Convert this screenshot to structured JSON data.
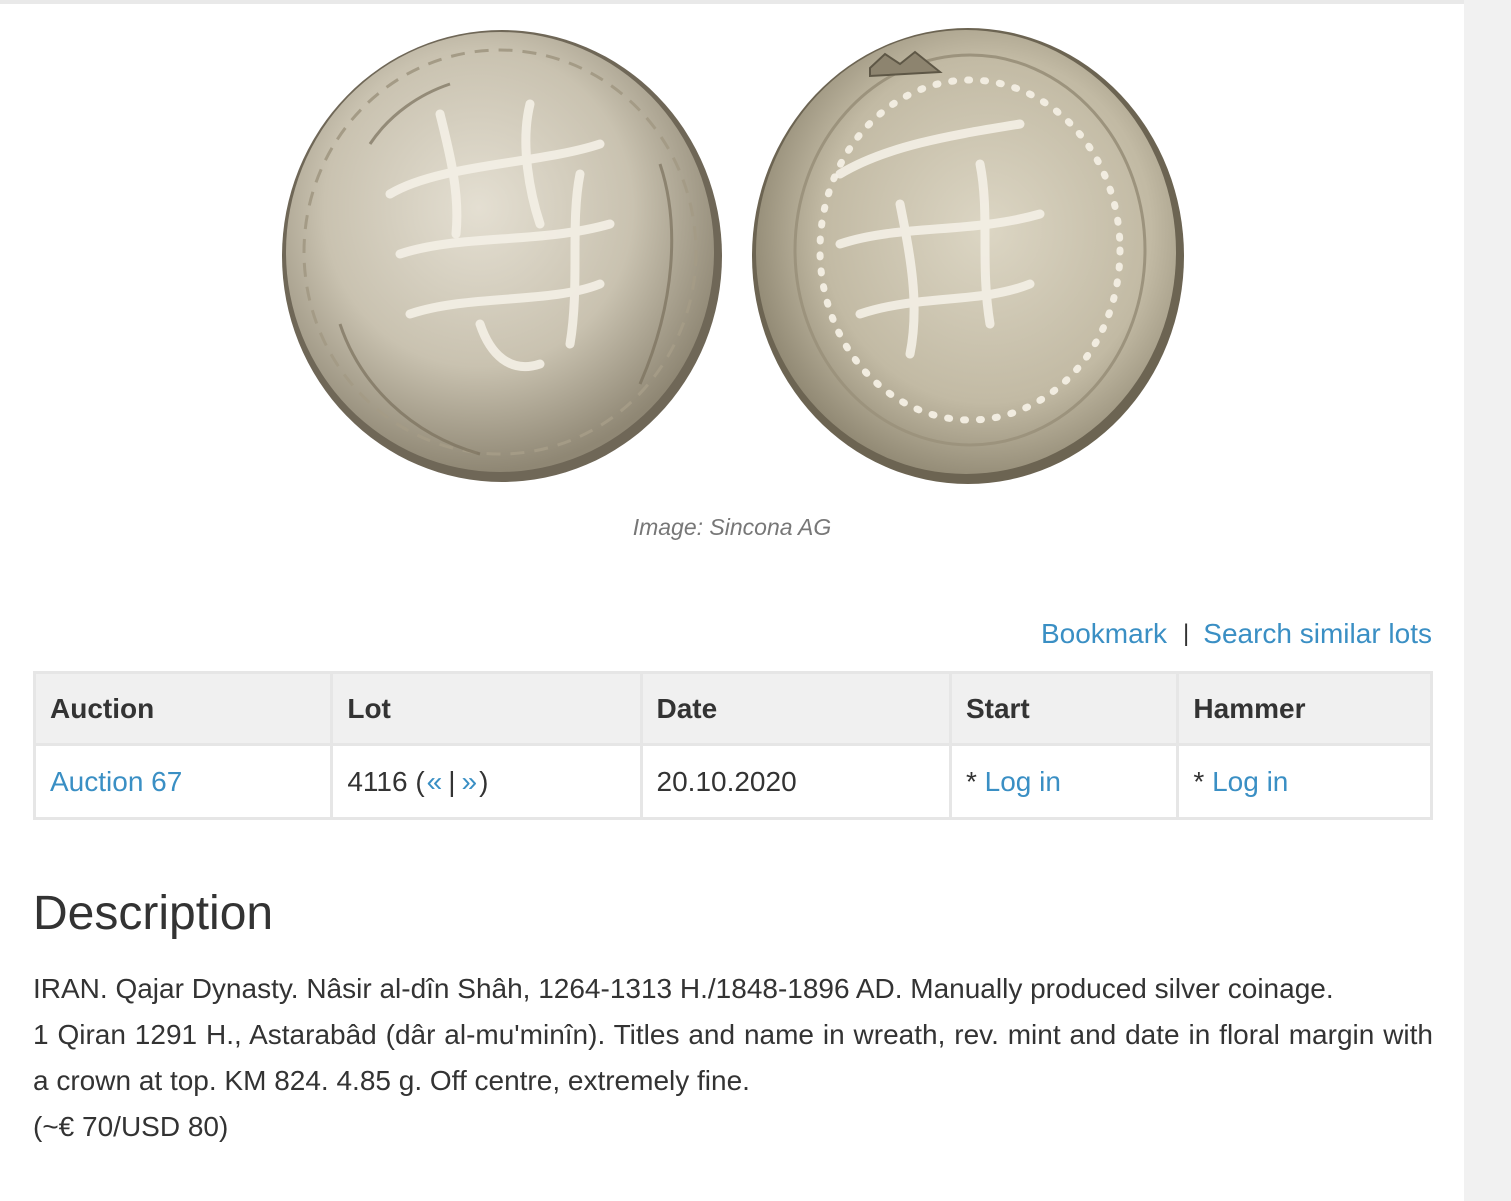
{
  "image": {
    "alt": "Silver coin obverse and reverse",
    "caption": "Image: Sincona AG"
  },
  "actions": {
    "bookmark_label": "Bookmark",
    "separator": "|",
    "search_similar_label": "Search similar lots"
  },
  "table": {
    "headers": {
      "auction": "Auction",
      "lot": "Lot",
      "date": "Date",
      "start": "Start",
      "hammer": "Hammer"
    },
    "row": {
      "auction": "Auction 67",
      "lot_number": "4116",
      "lot_open": " (",
      "prev": "«",
      "bar": "|",
      "next": "»",
      "lot_close": ")",
      "date": "20.10.2020",
      "start_prefix": "* ",
      "start_link": "Log in",
      "hammer_prefix": "* ",
      "hammer_link": "Log in"
    }
  },
  "description": {
    "heading": "Description",
    "paragraph1": "IRAN. Qajar Dynasty. Nâsir al-dîn Shâh, 1264-1313 H./1848-1896 AD. Manually produced silver coinage.",
    "paragraph2": "1 Qiran 1291 H., Astarabâd (dâr al-mu'minîn). Titles and name in wreath, rev. mint and date in floral margin with a crown at top. KM 824. 4.85 g. Off centre, extremely fine.",
    "paragraph3": "(~€ 70/USD 80)"
  },
  "colors": {
    "link": "#3a8fc4",
    "text": "#333333",
    "caption": "#777777",
    "table_header_bg": "#f0f0f0",
    "table_border": "#e6e6e6"
  }
}
